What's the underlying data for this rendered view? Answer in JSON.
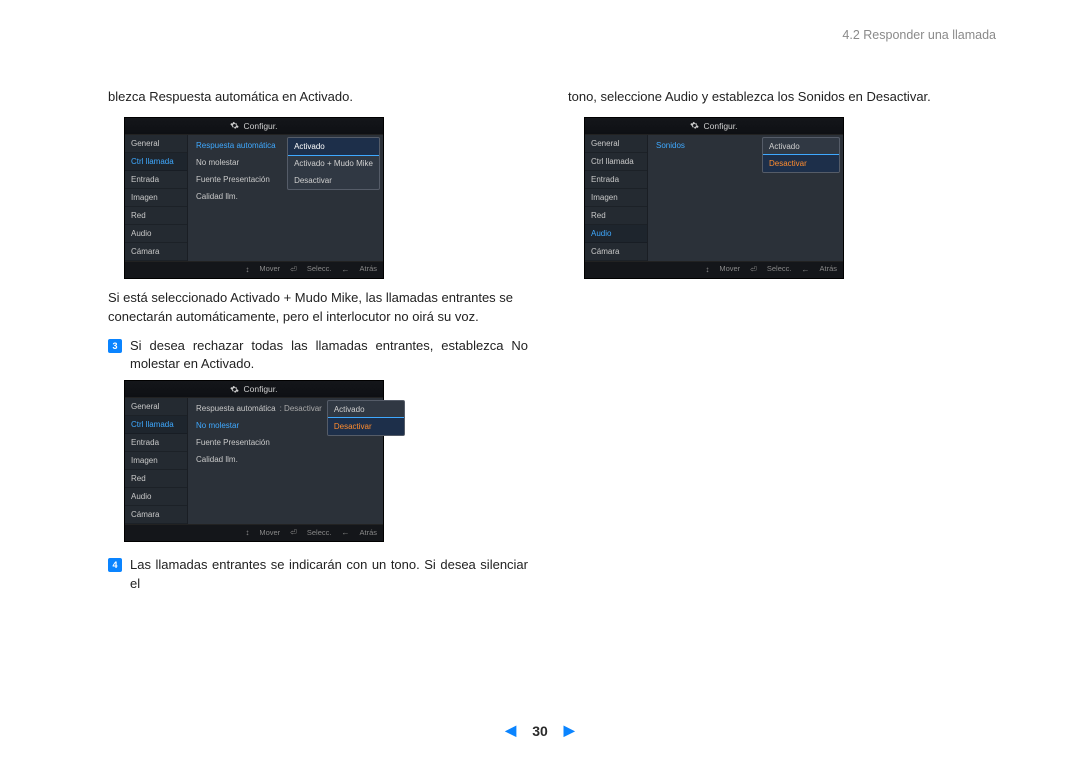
{
  "breadcrumb": "4.2 Responder una llamada",
  "page_number": "30",
  "col_left": {
    "intro": "blezca Respuesta automática en Activado.",
    "note": "Si está seleccionado Activado + Mudo Mike, las llamadas entrantes se conectarán automáticamente, pero el interlocutor no oirá su voz.",
    "step3_text": "Si desea rechazar todas las llamadas entrantes, establezca No molestar en Activado.",
    "step4_text": "Las llamadas entrantes se indicarán con un tono. Si desea silenciar el"
  },
  "col_right": {
    "intro": "tono, seleccione Audio y establezca los Sonidos en Desactivar."
  },
  "osd_common": {
    "title": "Configur.",
    "footer_mover": "Mover",
    "footer_selecc": "Selecc.",
    "footer_atras": "Atrás"
  },
  "sidebar_items": [
    "General",
    "Ctrl llamada",
    "Entrada",
    "Imagen",
    "Red",
    "Audio",
    "Cámara"
  ],
  "shot1": {
    "sidebar_highlight": "Ctrl llamada",
    "mid": [
      {
        "label": "Respuesta automática",
        "hl": true
      },
      {
        "label": "No molestar"
      },
      {
        "label": "Fuente Presentación"
      },
      {
        "label": "Calidad llm."
      }
    ],
    "popup": {
      "options": [
        "Activado",
        "Activado + Mudo Mike",
        "Desactivar"
      ],
      "selected": 0,
      "style": "blue"
    }
  },
  "shot2": {
    "sidebar_highlight": "Ctrl llamada",
    "mid": [
      {
        "label": "Respuesta automática",
        "val": ": Desactivar"
      },
      {
        "label": "No molestar",
        "hl": true
      },
      {
        "label": "Fuente Presentación"
      },
      {
        "label": "Calidad llm."
      }
    ],
    "popup": {
      "options": [
        "Activado",
        "Desactivar"
      ],
      "selected": 1,
      "style": "orange"
    }
  },
  "shot3": {
    "sidebar_highlight": "Audio",
    "mid": [
      {
        "label": "Sonidos",
        "hl": true
      }
    ],
    "popup": {
      "options": [
        "Activado",
        "Desactivar"
      ],
      "selected": 1,
      "style": "orange"
    }
  }
}
